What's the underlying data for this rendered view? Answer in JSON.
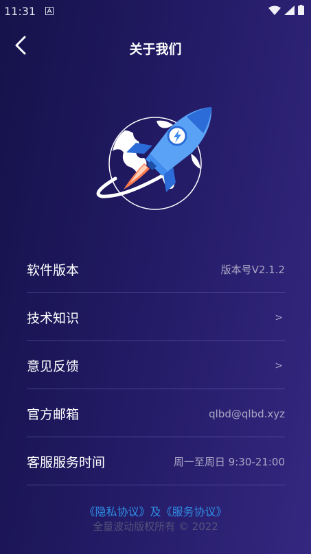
{
  "status_bar": {
    "time": "11:31",
    "left_icon": "notification-a-icon",
    "right_icons": [
      "wifi-icon",
      "signal-icon",
      "battery-icon"
    ]
  },
  "header": {
    "title": "关于我们",
    "back_icon": "chevron-left-icon"
  },
  "hero": {
    "illustration": "rocket-globe-icon"
  },
  "rows": [
    {
      "label": "软件版本",
      "value": "版本号V2.1.2"
    },
    {
      "label": "技术知识",
      "value": ">"
    },
    {
      "label": "意见反馈",
      "value": ">"
    },
    {
      "label": "官方邮箱",
      "value": "qlbd@qlbd.xyz"
    },
    {
      "label": "客服服务时间",
      "value": "周一至周日 9:30-21:00"
    }
  ],
  "footer": {
    "privacy_link": "《隐私协议》",
    "joiner": "及",
    "service_link": "《服务协议》",
    "copyright": "全量波动版权所有 © 2022"
  },
  "colors": {
    "background_start": "#15124a",
    "background_end": "#342780",
    "link": "#2f8ee6",
    "divider": "#5a4fb0",
    "rocket_blue": "#3f8df0"
  }
}
